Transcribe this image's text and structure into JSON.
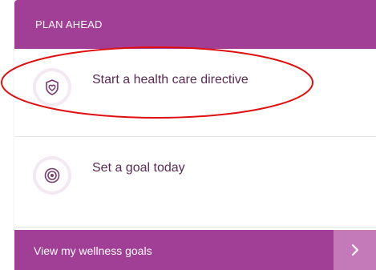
{
  "section": {
    "title": "PLAN AHEAD"
  },
  "items": [
    {
      "label": "Start a health care directive",
      "icon": "shield-heart-icon"
    },
    {
      "label": "Set a goal today",
      "icon": "target-icon"
    }
  ],
  "footer": {
    "label": "View my wellness goals",
    "arrow_icon": "chevron-right-icon"
  },
  "colors": {
    "brand": "#a13e96",
    "brand_light": "#c47ab9",
    "text": "#5a2a55",
    "annotation": "#e01010"
  }
}
